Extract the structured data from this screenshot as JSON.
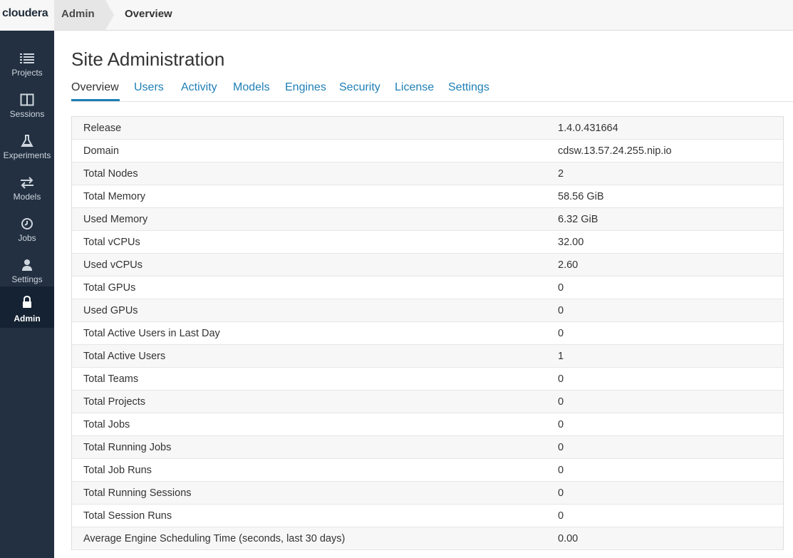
{
  "brand": {
    "logo_text": "cloudera"
  },
  "breadcrumb": {
    "admin": "Admin",
    "current": "Overview"
  },
  "sidebar": {
    "items": [
      {
        "label": "Projects",
        "icon": "list-icon"
      },
      {
        "label": "Sessions",
        "icon": "columns-icon"
      },
      {
        "label": "Experiments",
        "icon": "flask-icon"
      },
      {
        "label": "Models",
        "icon": "arrows-exchange-icon"
      },
      {
        "label": "Jobs",
        "icon": "clock-icon"
      },
      {
        "label": "Settings",
        "icon": "user-icon"
      },
      {
        "label": "Admin",
        "icon": "lock-icon",
        "active": true
      }
    ]
  },
  "page": {
    "title": "Site Administration"
  },
  "tabs": [
    {
      "label": "Overview",
      "active": true
    },
    {
      "label": "Users"
    },
    {
      "label": "Activity"
    },
    {
      "label": "Models"
    },
    {
      "label": "Engines"
    },
    {
      "label": "Security"
    },
    {
      "label": "License"
    },
    {
      "label": "Settings"
    }
  ],
  "stats": [
    {
      "key": "Release",
      "value": "1.4.0.431664"
    },
    {
      "key": "Domain",
      "value": "cdsw.13.57.24.255.nip.io"
    },
    {
      "key": "Total Nodes",
      "value": "2"
    },
    {
      "key": "Total Memory",
      "value": "58.56 GiB"
    },
    {
      "key": "Used Memory",
      "value": "6.32 GiB"
    },
    {
      "key": "Total vCPUs",
      "value": "32.00"
    },
    {
      "key": "Used vCPUs",
      "value": "2.60"
    },
    {
      "key": "Total GPUs",
      "value": "0"
    },
    {
      "key": "Used GPUs",
      "value": "0"
    },
    {
      "key": "Total Active Users in Last Day",
      "value": "0"
    },
    {
      "key": "Total Active Users",
      "value": "1"
    },
    {
      "key": "Total Teams",
      "value": "0"
    },
    {
      "key": "Total Projects",
      "value": "0"
    },
    {
      "key": "Total Jobs",
      "value": "0"
    },
    {
      "key": "Total Running Jobs",
      "value": "0"
    },
    {
      "key": "Total Job Runs",
      "value": "0"
    },
    {
      "key": "Total Running Sessions",
      "value": "0"
    },
    {
      "key": "Total Session Runs",
      "value": "0"
    },
    {
      "key": "Average Engine Scheduling Time (seconds, last 30 days)",
      "value": "0.00"
    }
  ],
  "colors": {
    "sidebar_bg": "#223041",
    "sidebar_active_bg": "#152233",
    "link": "#1e7fb6"
  }
}
